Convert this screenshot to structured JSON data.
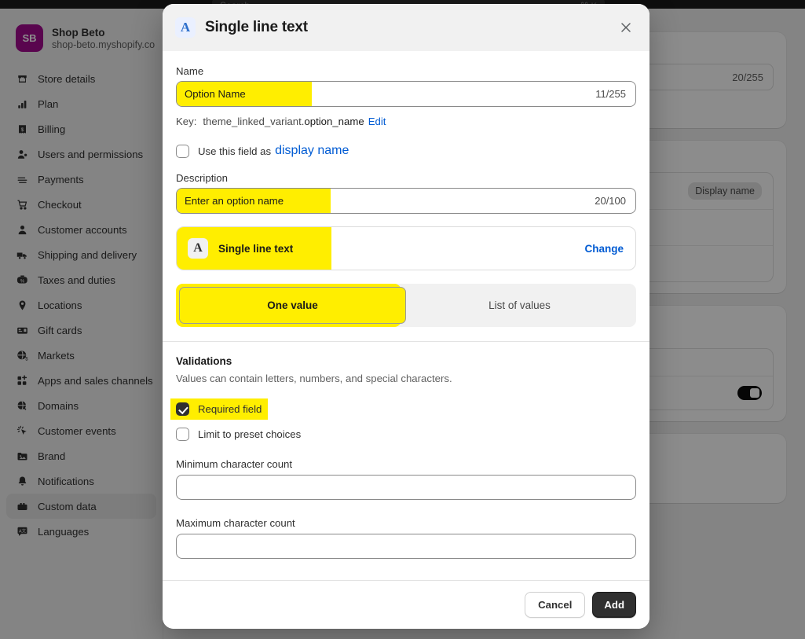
{
  "topbar": {
    "search_placeholder": "Search",
    "shortcut": "⌘ K"
  },
  "sidebar": {
    "shop": {
      "name": "Shop Beto",
      "domain": "shop-beto.myshopify.co"
    },
    "items": [
      {
        "label": "Store details",
        "icon": "store-icon",
        "active": false
      },
      {
        "label": "Plan",
        "icon": "plan-icon",
        "active": false
      },
      {
        "label": "Billing",
        "icon": "billing-icon",
        "active": false
      },
      {
        "label": "Users and permissions",
        "icon": "users-icon",
        "active": false
      },
      {
        "label": "Payments",
        "icon": "payments-icon",
        "active": false
      },
      {
        "label": "Checkout",
        "icon": "cart-icon",
        "active": false
      },
      {
        "label": "Customer accounts",
        "icon": "person-icon",
        "active": false
      },
      {
        "label": "Shipping and delivery",
        "icon": "truck-icon",
        "active": false
      },
      {
        "label": "Taxes and duties",
        "icon": "taxes-icon",
        "active": false
      },
      {
        "label": "Locations",
        "icon": "location-pin-icon",
        "active": false
      },
      {
        "label": "Gift cards",
        "icon": "gift-card-icon",
        "active": false
      },
      {
        "label": "Markets",
        "icon": "globe-dollar-icon",
        "active": false
      },
      {
        "label": "Apps and sales channels",
        "icon": "apps-plus-icon",
        "active": false
      },
      {
        "label": "Domains",
        "icon": "globe-icon",
        "active": false
      },
      {
        "label": "Customer events",
        "icon": "cursor-click-icon",
        "active": false
      },
      {
        "label": "Brand",
        "icon": "brand-image-icon",
        "active": false
      },
      {
        "label": "Notifications",
        "icon": "bell-icon",
        "active": false
      },
      {
        "label": "Custom data",
        "icon": "custom-data-icon",
        "active": true
      },
      {
        "label": "Languages",
        "icon": "languages-icon",
        "active": false
      }
    ]
  },
  "background_main": {
    "counter_255": "20/255",
    "display_name_pill": "Display name"
  },
  "modal": {
    "title": "Single line text",
    "type_badge_glyph": "A",
    "close_icon": "close-icon",
    "name": {
      "label": "Name",
      "value": "Option Name",
      "counter": "11/255"
    },
    "key": {
      "label": "Key:",
      "prefix": "theme_linked_variant.",
      "suffix": "option_name",
      "edit_label": "Edit"
    },
    "display_name_checkbox": {
      "text_before": "Use this field as",
      "link": "display name",
      "checked": false
    },
    "description": {
      "label": "Description",
      "value": "Enter an option name",
      "counter": "20/100"
    },
    "type_picker": {
      "icon_glyph": "A",
      "name": "Single line text",
      "change_label": "Change"
    },
    "segmented": {
      "options": [
        "One value",
        "List of values"
      ],
      "selected": "One value"
    },
    "validations": {
      "title": "Validations",
      "description": "Values can contain letters, numbers, and special characters.",
      "required_field": {
        "label": "Required field",
        "checked": true
      },
      "preset_choices": {
        "label": "Limit to preset choices",
        "checked": false
      },
      "min_count": {
        "label": "Minimum character count",
        "value": ""
      },
      "max_count": {
        "label": "Maximum character count",
        "value": ""
      }
    },
    "footer": {
      "cancel_label": "Cancel",
      "add_label": "Add"
    }
  },
  "colors": {
    "highlight": "#ffee00",
    "link": "#005bd3",
    "avatar": "#a20a8f",
    "primary_button": "#303030"
  }
}
